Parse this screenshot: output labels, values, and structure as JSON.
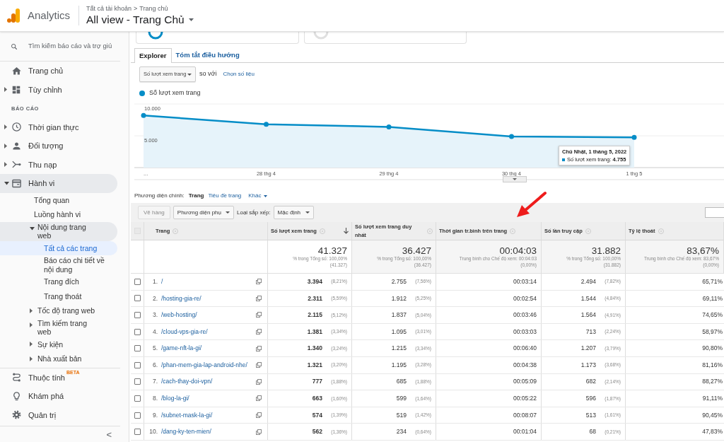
{
  "header": {
    "product": "Analytics",
    "breadcrumb": [
      "Tất cả tài khoản",
      "Trang chủ"
    ],
    "breadcrumb_separator": ">",
    "view_title": "All view - Trang Chủ"
  },
  "sidebar": {
    "search_placeholder": "Tìm kiếm báo cáo và trợ giú",
    "items": [
      {
        "kind": "link",
        "label": "Trang chủ",
        "selected": false
      },
      {
        "kind": "group",
        "label": "Tùy chỉnh",
        "expanded": false
      },
      {
        "kind": "section",
        "label": "BÁO CÁO"
      },
      {
        "kind": "group",
        "label": "Thời gian thực",
        "expanded": false
      },
      {
        "kind": "group",
        "label": "Đối tượng",
        "expanded": false
      },
      {
        "kind": "group",
        "label": "Thu nạp",
        "expanded": false
      },
      {
        "kind": "group",
        "label": "Hành vi",
        "expanded": true,
        "children": [
          {
            "kind": "link",
            "label": "Tổng quan",
            "selected": false
          },
          {
            "kind": "link",
            "label": "Luồng hành vi",
            "selected": false
          },
          {
            "kind": "group",
            "label": "Nội dung trang web",
            "expanded": true,
            "children": [
              {
                "kind": "link",
                "label": "Tất cả các trang",
                "selected": true
              },
              {
                "kind": "link",
                "label": "Báo cáo chi tiết về nội dung",
                "selected": false
              },
              {
                "kind": "link",
                "label": "Trang đích",
                "selected": false
              },
              {
                "kind": "link",
                "label": "Trang thoát",
                "selected": false
              }
            ]
          },
          {
            "kind": "group",
            "label": "Tốc độ trang web",
            "expanded": false
          },
          {
            "kind": "group",
            "label": "Tìm kiếm trang web",
            "expanded": false
          },
          {
            "kind": "group",
            "label": "Sự kiện",
            "expanded": false
          },
          {
            "kind": "group",
            "label": "Nhà xuất bản",
            "expanded": false
          }
        ]
      }
    ],
    "bottom_items": [
      {
        "label": "Thuộc tính",
        "badge": "BETA",
        "selected": false
      },
      {
        "label": "Khám phá",
        "selected": false
      },
      {
        "label": "Quản trị",
        "selected": false
      }
    ],
    "collapse": "<"
  },
  "explorer": {
    "tabs": [
      {
        "label": "Explorer",
        "selected": true
      },
      {
        "label": "Tóm tắt điều hướng",
        "selected": false
      }
    ],
    "metric_select": "Số lượt xem trang",
    "compare_text": "so với",
    "choose_metric": "Chọn số liệu",
    "chart_data": {
      "type": "line",
      "categories": [
        "...",
        "28 thg 4",
        "29 thg 4",
        "30 thg 4",
        "1 thg 5"
      ],
      "series": [
        {
          "name": "Số lượt xem trang",
          "color": "#058dc7",
          "marker": true,
          "values": [
            8200,
            6800,
            6400,
            4900,
            4755
          ]
        }
      ],
      "ylim": [
        0,
        10000
      ],
      "yticks": [
        {
          "value": 5000,
          "label": "5.000"
        },
        {
          "value": 10000,
          "label": "10.000"
        }
      ]
    },
    "tooltip": {
      "title": "Chủ Nhật, 1 tháng 5, 2022",
      "line": "Số lượt xem trang: **4.755**"
    }
  },
  "dimension_bar": {
    "label": "Phương diện chính:",
    "options": [
      {
        "kind": "option",
        "label": "Trang",
        "selected": true
      },
      {
        "kind": "option",
        "label": "Tiêu đề trang",
        "selected": false
      },
      {
        "kind": "menu",
        "label": "Khác",
        "selected": false
      }
    ]
  },
  "toolbar": {
    "plot_rows": {
      "label": "Vẽ hàng",
      "disabled": true
    },
    "secondary_dimension": "Phương diện phụ",
    "sort_label": "Loại sắp xếp:",
    "sort_value": "Mặc định"
  },
  "table": {
    "select_all_disabled": true,
    "columns": [
      {
        "label": "Trang",
        "sorted": false
      },
      {
        "label": "Số lượt xem trang",
        "sorted": true
      },
      {
        "label": "Số lượt xem trang duy nhất",
        "sorted": false
      },
      {
        "label": "Thời gian tr.bình trên trang",
        "sorted": false
      },
      {
        "label": "Số lần truy cập",
        "sorted": false
      },
      {
        "label": "Tỷ lệ thoát",
        "sorted": false
      }
    ],
    "totals": [
      {
        "value": "41.327",
        "note": "% trong Tổng số: 100,00%",
        "note_detail": "(41.327)"
      },
      {
        "value": "36.427",
        "note": "% trong Tổng số: 100,00%",
        "note_detail": "(36.427)"
      },
      {
        "value": "00:04:03",
        "note": "Trung bình cho Chế độ xem: 00:04:03",
        "note_detail": "(0,00%)"
      },
      {
        "value": "31.882",
        "note": "% trong Tổng số: 100,00%",
        "note_detail": "(31.882)"
      },
      {
        "value": "83,67%",
        "note": "Trung bình cho Chế độ xem: 83,67%",
        "note_detail": "(0,00%)"
      }
    ],
    "rows": [
      {
        "checked": false,
        "index": "1.",
        "page": "/",
        "views": "3.394",
        "views_pct": "(8,21%)",
        "unique": "2.755",
        "unique_pct": "(7,56%)",
        "avg_time": "00:03:14",
        "visits": "2.494",
        "visits_pct": "(7,82%)",
        "bounce": "65,71%"
      },
      {
        "checked": false,
        "index": "2.",
        "page": "/hosting-gia-re/",
        "views": "2.311",
        "views_pct": "(5,59%)",
        "unique": "1.912",
        "unique_pct": "(5,25%)",
        "avg_time": "00:02:54",
        "visits": "1.544",
        "visits_pct": "(4,84%)",
        "bounce": "69,11%"
      },
      {
        "checked": false,
        "index": "3.",
        "page": "/web-hosting/",
        "views": "2.115",
        "views_pct": "(5,12%)",
        "unique": "1.837",
        "unique_pct": "(5,04%)",
        "avg_time": "00:03:46",
        "visits": "1.564",
        "visits_pct": "(4,91%)",
        "bounce": "74,65%"
      },
      {
        "checked": false,
        "index": "4.",
        "page": "/cloud-vps-gia-re/",
        "views": "1.381",
        "views_pct": "(3,34%)",
        "unique": "1.095",
        "unique_pct": "(3,01%)",
        "avg_time": "00:03:03",
        "visits": "713",
        "visits_pct": "(2,24%)",
        "bounce": "58,97%"
      },
      {
        "checked": false,
        "index": "5.",
        "page": "/game-nft-la-gi/",
        "views": "1.340",
        "views_pct": "(3,24%)",
        "unique": "1.215",
        "unique_pct": "(3,34%)",
        "avg_time": "00:06:40",
        "visits": "1.207",
        "visits_pct": "(3,79%)",
        "bounce": "90,80%"
      },
      {
        "checked": false,
        "index": "6.",
        "page": "/phan-mem-gia-lap-android-nhe/",
        "views": "1.321",
        "views_pct": "(3,20%)",
        "unique": "1.195",
        "unique_pct": "(3,28%)",
        "avg_time": "00:04:38",
        "visits": "1.173",
        "visits_pct": "(3,68%)",
        "bounce": "81,16%"
      },
      {
        "checked": false,
        "index": "7.",
        "page": "/cach-thay-doi-vpn/",
        "views": "777",
        "views_pct": "(1,88%)",
        "unique": "685",
        "unique_pct": "(1,88%)",
        "avg_time": "00:05:09",
        "visits": "682",
        "visits_pct": "(2,14%)",
        "bounce": "88,27%"
      },
      {
        "checked": false,
        "index": "8.",
        "page": "/blog-la-gi/",
        "views": "663",
        "views_pct": "(1,60%)",
        "unique": "599",
        "unique_pct": "(1,64%)",
        "avg_time": "00:05:22",
        "visits": "596",
        "visits_pct": "(1,87%)",
        "bounce": "91,11%"
      },
      {
        "checked": false,
        "index": "9.",
        "page": "/subnet-mask-la-gi/",
        "views": "574",
        "views_pct": "(1,39%)",
        "unique": "519",
        "unique_pct": "(1,42%)",
        "avg_time": "00:08:07",
        "visits": "513",
        "visits_pct": "(1,61%)",
        "bounce": "90,45%"
      },
      {
        "checked": false,
        "index": "10.",
        "page": "/dang-ky-ten-mien/",
        "views": "562",
        "views_pct": "(1,36%)",
        "unique": "234",
        "unique_pct": "(0,64%)",
        "avg_time": "00:01:04",
        "visits": "68",
        "visits_pct": "(0,21%)",
        "bounce": "47,83%"
      }
    ]
  }
}
